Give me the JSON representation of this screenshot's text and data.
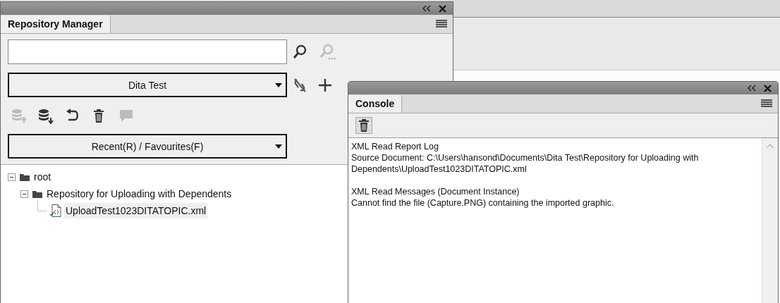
{
  "repository_manager": {
    "tab": {
      "label": "Repository Manager",
      "selected": true
    },
    "search": {
      "secondary_disabled": true
    },
    "repository": {
      "value": "Dita Test"
    },
    "toolbar": [
      {
        "kind": "upload",
        "disabled": true
      },
      {
        "kind": "download",
        "disabled": false
      },
      {
        "kind": "undo",
        "disabled": false
      },
      {
        "kind": "delete",
        "disabled": false
      },
      {
        "kind": "comment",
        "disabled": true
      }
    ],
    "recent": {
      "value": "Recent(R) / Favourites(F)"
    },
    "tree": [
      {
        "label": "root",
        "kind": "folder",
        "expanded": true,
        "selected": false,
        "children": [
          {
            "label": "Repository for Uploading with Dependents",
            "kind": "folder",
            "expanded": true,
            "selected": false,
            "children": [
              {
                "label": "UploadTest1023DITATOPIC.xml",
                "kind": "file",
                "selected": true
              }
            ]
          }
        ]
      }
    ]
  },
  "console": {
    "tab": {
      "label": "Console",
      "selected": true
    },
    "messages": [
      [
        "XML Read Report Log",
        "Source Document: C:\\Users\\hansond\\Documents\\Dita Test\\Repository for Uploading with",
        "Dependents\\UploadTest1023DITATOPIC.xml"
      ],
      [
        "XML Read Messages (Document Instance)",
        "Cannot find the file (Capture.PNG) containing the imported graphic."
      ]
    ]
  }
}
